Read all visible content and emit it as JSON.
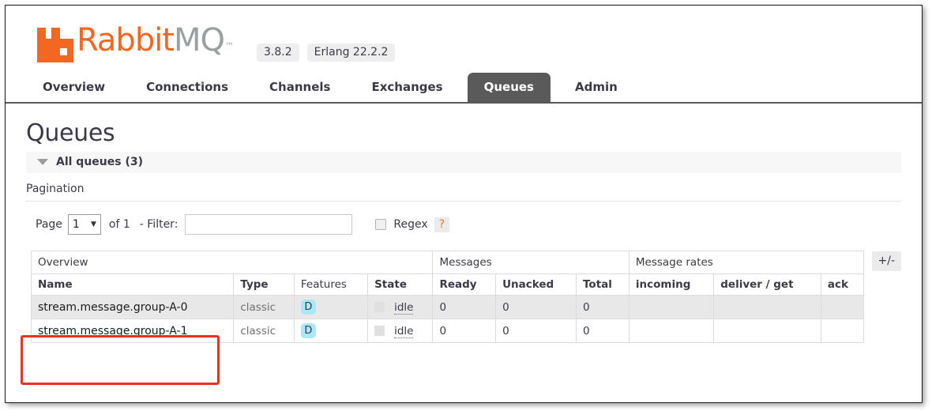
{
  "header": {
    "logo_text_primary": "Rabbit",
    "logo_text_secondary": "MQ",
    "logo_trademark": "™",
    "version_badge": "3.8.2",
    "erlang_badge": "Erlang 22.2.2"
  },
  "nav": {
    "tabs": [
      {
        "label": "Overview",
        "active": false
      },
      {
        "label": "Connections",
        "active": false
      },
      {
        "label": "Channels",
        "active": false
      },
      {
        "label": "Exchanges",
        "active": false
      },
      {
        "label": "Queues",
        "active": true
      },
      {
        "label": "Admin",
        "active": false
      }
    ]
  },
  "main": {
    "page_title": "Queues",
    "all_queues_label": "All queues (3)",
    "pagination_label": "Pagination"
  },
  "pagination": {
    "page_label": "Page",
    "page_value": "1",
    "caret": "▼",
    "of_label": "of 1",
    "filter_label": "- Filter:",
    "filter_value": "",
    "filter_placeholder": "",
    "regex_label": "Regex",
    "help_label": "?"
  },
  "table": {
    "group_headers": [
      {
        "label": "Overview",
        "colspan": 4
      },
      {
        "label": "Messages",
        "colspan": 3
      },
      {
        "label": "Message rates",
        "colspan": 3
      }
    ],
    "columns": [
      {
        "label": "Name",
        "bold": true,
        "align": "left"
      },
      {
        "label": "Type",
        "bold": true,
        "align": "left"
      },
      {
        "label": "Features",
        "bold": false,
        "align": "left"
      },
      {
        "label": "State",
        "bold": true,
        "align": "left"
      },
      {
        "label": "Ready",
        "bold": true,
        "align": "left"
      },
      {
        "label": "Unacked",
        "bold": true,
        "align": "left"
      },
      {
        "label": "Total",
        "bold": true,
        "align": "left"
      },
      {
        "label": "incoming",
        "bold": true,
        "align": "left"
      },
      {
        "label": "deliver / get",
        "bold": true,
        "align": "left"
      },
      {
        "label": "ack",
        "bold": true,
        "align": "left"
      }
    ],
    "plus_minus_label": "+/-",
    "rows": [
      {
        "name": "stream.message.group-A-0",
        "type": "classic",
        "features": "D",
        "state": "idle",
        "ready": "0",
        "unacked": "0",
        "total": "0",
        "incoming": "",
        "deliver_get": "",
        "ack": ""
      },
      {
        "name": "stream.message.group-A-1",
        "type": "classic",
        "features": "D",
        "state": "idle",
        "ready": "0",
        "unacked": "0",
        "total": "0",
        "incoming": "",
        "deliver_get": "",
        "ack": ""
      }
    ]
  },
  "colors": {
    "brand_orange": "#f26722",
    "logo_gray": "#9aa0a0",
    "active_tab": "#5a5a5a",
    "durable_badge": "#a9e9f7",
    "annotation_red": "#ea3223",
    "row_alt": "#e8e8e8"
  }
}
